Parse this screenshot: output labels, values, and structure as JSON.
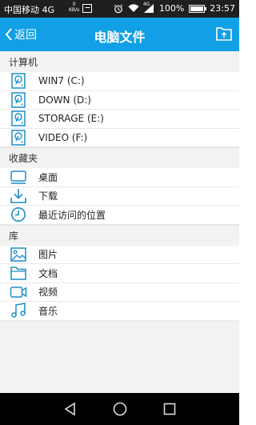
{
  "status": {
    "carrier": "中国移动 4G",
    "net_speed_value": "0",
    "net_speed_unit": "KB/s",
    "signal_label": "4G",
    "battery": "100%",
    "time": "23:57"
  },
  "header": {
    "back_label": "返回",
    "title": "电脑文件"
  },
  "sections": [
    {
      "title": "计算机",
      "items": [
        {
          "label": "WIN7 (C:)",
          "icon": "hard-drive-icon"
        },
        {
          "label": "DOWN (D:)",
          "icon": "hard-drive-icon"
        },
        {
          "label": "STORAGE (E:)",
          "icon": "hard-drive-icon"
        },
        {
          "label": "VIDEO (F:)",
          "icon": "hard-drive-icon"
        }
      ]
    },
    {
      "title": "收藏夹",
      "items": [
        {
          "label": "桌面",
          "icon": "desktop-icon"
        },
        {
          "label": "下载",
          "icon": "download-icon"
        },
        {
          "label": "最近访问的位置",
          "icon": "clock-icon"
        }
      ]
    },
    {
      "title": "库",
      "items": [
        {
          "label": "图片",
          "icon": "image-icon"
        },
        {
          "label": "文档",
          "icon": "folder-icon"
        },
        {
          "label": "视频",
          "icon": "video-icon"
        },
        {
          "label": "音乐",
          "icon": "music-icon"
        }
      ]
    }
  ],
  "colors": {
    "accent": "#11a0e6",
    "status_bar": "#1f1f1f",
    "nav_bar": "#000000",
    "background": "#f2f2f2"
  }
}
